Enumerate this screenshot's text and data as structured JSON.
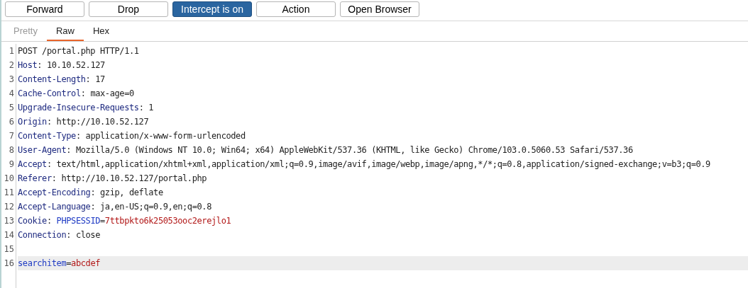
{
  "toolbar": {
    "buttons": [
      {
        "label": "Forward",
        "active": false
      },
      {
        "label": "Drop",
        "active": false
      },
      {
        "label": "Intercept is on",
        "active": true
      },
      {
        "label": "Action",
        "active": false
      },
      {
        "label": "Open Browser",
        "active": false
      }
    ]
  },
  "tabs": [
    {
      "label": "Pretty",
      "selected": false,
      "disabled": true
    },
    {
      "label": "Raw",
      "selected": true,
      "disabled": false
    },
    {
      "label": "Hex",
      "selected": false,
      "disabled": false
    }
  ],
  "editor": {
    "lines": [
      {
        "number": "1",
        "current": false,
        "segments": [
          {
            "kind": "text",
            "text": "POST /portal.php HTTP/1.1"
          }
        ]
      },
      {
        "number": "2",
        "current": false,
        "segments": [
          {
            "kind": "header",
            "text": "Host"
          },
          {
            "kind": "text",
            "text": ": 10.10.52.127"
          }
        ]
      },
      {
        "number": "3",
        "current": false,
        "segments": [
          {
            "kind": "header",
            "text": "Content-Length"
          },
          {
            "kind": "text",
            "text": ": 17"
          }
        ]
      },
      {
        "number": "4",
        "current": false,
        "segments": [
          {
            "kind": "header",
            "text": "Cache-Control"
          },
          {
            "kind": "text",
            "text": ": max-age=0"
          }
        ]
      },
      {
        "number": "5",
        "current": false,
        "segments": [
          {
            "kind": "header",
            "text": "Upgrade-Insecure-Requests"
          },
          {
            "kind": "text",
            "text": ": 1"
          }
        ]
      },
      {
        "number": "6",
        "current": false,
        "segments": [
          {
            "kind": "header",
            "text": "Origin"
          },
          {
            "kind": "text",
            "text": ": http://10.10.52.127"
          }
        ]
      },
      {
        "number": "7",
        "current": false,
        "segments": [
          {
            "kind": "header",
            "text": "Content-Type"
          },
          {
            "kind": "text",
            "text": ": application/x-www-form-urlencoded"
          }
        ]
      },
      {
        "number": "8",
        "current": false,
        "segments": [
          {
            "kind": "header",
            "text": "User-Agent"
          },
          {
            "kind": "text",
            "text": ": Mozilla/5.0 (Windows NT 10.0; Win64; x64) AppleWebKit/537.36 (KHTML, like Gecko) Chrome/103.0.5060.53 Safari/537.36"
          }
        ]
      },
      {
        "number": "9",
        "current": false,
        "segments": [
          {
            "kind": "header",
            "text": "Accept"
          },
          {
            "kind": "text",
            "text": ": text/html,application/xhtml+xml,application/xml;q=0.9,image/avif,image/webp,image/apng,*/*;q=0.8,application/signed-exchange;v=b3;q=0.9"
          }
        ]
      },
      {
        "number": "10",
        "current": false,
        "segments": [
          {
            "kind": "header",
            "text": "Referer"
          },
          {
            "kind": "text",
            "text": ": http://10.10.52.127/portal.php"
          }
        ]
      },
      {
        "number": "11",
        "current": false,
        "segments": [
          {
            "kind": "header",
            "text": "Accept-Encoding"
          },
          {
            "kind": "text",
            "text": ": gzip, deflate"
          }
        ]
      },
      {
        "number": "12",
        "current": false,
        "segments": [
          {
            "kind": "header",
            "text": "Accept-Language"
          },
          {
            "kind": "text",
            "text": ": ja,en-US;q=0.9,en;q=0.8"
          }
        ]
      },
      {
        "number": "13",
        "current": false,
        "segments": [
          {
            "kind": "header",
            "text": "Cookie"
          },
          {
            "kind": "text",
            "text": ": "
          },
          {
            "kind": "param_name",
            "text": "PHPSESSID"
          },
          {
            "kind": "text",
            "text": "="
          },
          {
            "kind": "param_value",
            "text": "7ttbpkto6k25053ooc2erejlo1"
          }
        ]
      },
      {
        "number": "14",
        "current": false,
        "segments": [
          {
            "kind": "header",
            "text": "Connection"
          },
          {
            "kind": "text",
            "text": ": close"
          }
        ]
      },
      {
        "number": "15",
        "current": false
      },
      {
        "number": "16",
        "current": true,
        "segments": [
          {
            "kind": "param_name",
            "text": "searchitem"
          },
          {
            "kind": "text",
            "text": "="
          },
          {
            "kind": "param_value",
            "text": "abcdef"
          }
        ]
      }
    ]
  }
}
